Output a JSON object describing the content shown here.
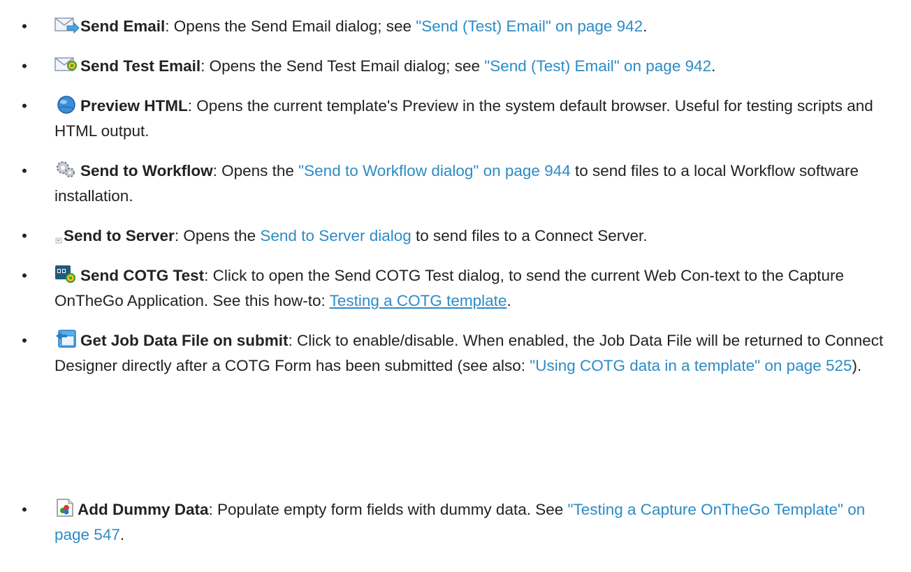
{
  "items": [
    {
      "title": "Send Email",
      "pre": ": Opens the Send Email dialog; see ",
      "link": "\"Send (Test) Email\" on page 942",
      "post": ".",
      "icon": "email-icon"
    },
    {
      "title": "Send Test Email",
      "pre": ": Opens the Send Test Email dialog; see ",
      "link": "\"Send (Test) Email\" on page 942",
      "post": ".",
      "icon": "test-email-icon"
    },
    {
      "title": "Preview HTML",
      "pre": ": Opens the current template's Preview in the system default browser. Useful for testing scripts and HTML output.",
      "icon": "globe-icon"
    },
    {
      "title": "Send to Workflow",
      "pre": ": Opens the ",
      "link": "\"Send to Workflow dialog\" on page 944",
      "post": " to send files to a local Workflow software installation.",
      "icon": "gears-icon"
    },
    {
      "title": "Send to Server",
      "pre": ": Opens the ",
      "link": "Send to Server dialog",
      "post": " to send files to a Connect Server.",
      "icon": "broken-image-icon"
    },
    {
      "title": "Send COTG Test",
      "pre": ": Click to open the Send COTG Test dialog, to send the current Web Con-text to the Capture OnTheGo Application. See this how-to: ",
      "link": "Testing a COTG template",
      "post": ".",
      "icon": "cotg-icon"
    },
    {
      "title": "Get Job Data File on submit",
      "pre": ": Click to enable/disable. When enabled, the Job Data File will be returned to Connect Designer directly after a COTG Form has been submitted (see also: ",
      "link": "\"Using COTG data in a template\" on page 525",
      "post": ").",
      "icon": "job-data-icon"
    },
    {
      "title": "Add Dummy Data",
      "pre": ": Populate empty form fields with dummy data. See ",
      "link": "\"Testing a Capture OnTheGo Template\" on page 547",
      "post": ".",
      "icon": "dummy-data-icon"
    }
  ],
  "colors": {
    "link": "#2e8bc4",
    "text": "#222222"
  }
}
